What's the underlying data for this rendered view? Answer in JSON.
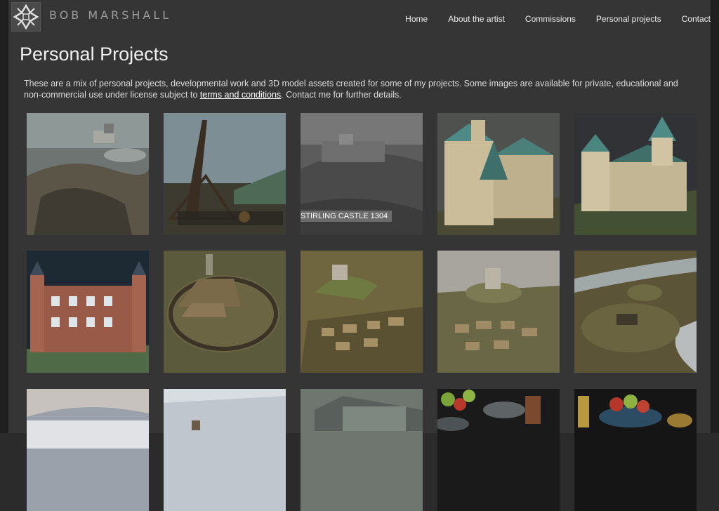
{
  "site": {
    "brand": "BOB MARSHALL",
    "nav": [
      "Home",
      "About the artist",
      "Commissions",
      "Personal projects",
      "Contact"
    ]
  },
  "page": {
    "title": "Personal Projects",
    "intro_before": "These are a mix of personal projects, developmental work and 3D model assets created for some of my projects. Some images are available for private, educational and non-commercial use under license subject to ",
    "intro_link": "terms and conditions",
    "intro_after": ". Contact me for further details."
  },
  "gallery": {
    "hover_caption": "STIRLING CASTLE 1304"
  },
  "colors": {
    "background": "#353535",
    "frame": "#1f1f1f",
    "caption_bg": "#6b6b6b"
  }
}
